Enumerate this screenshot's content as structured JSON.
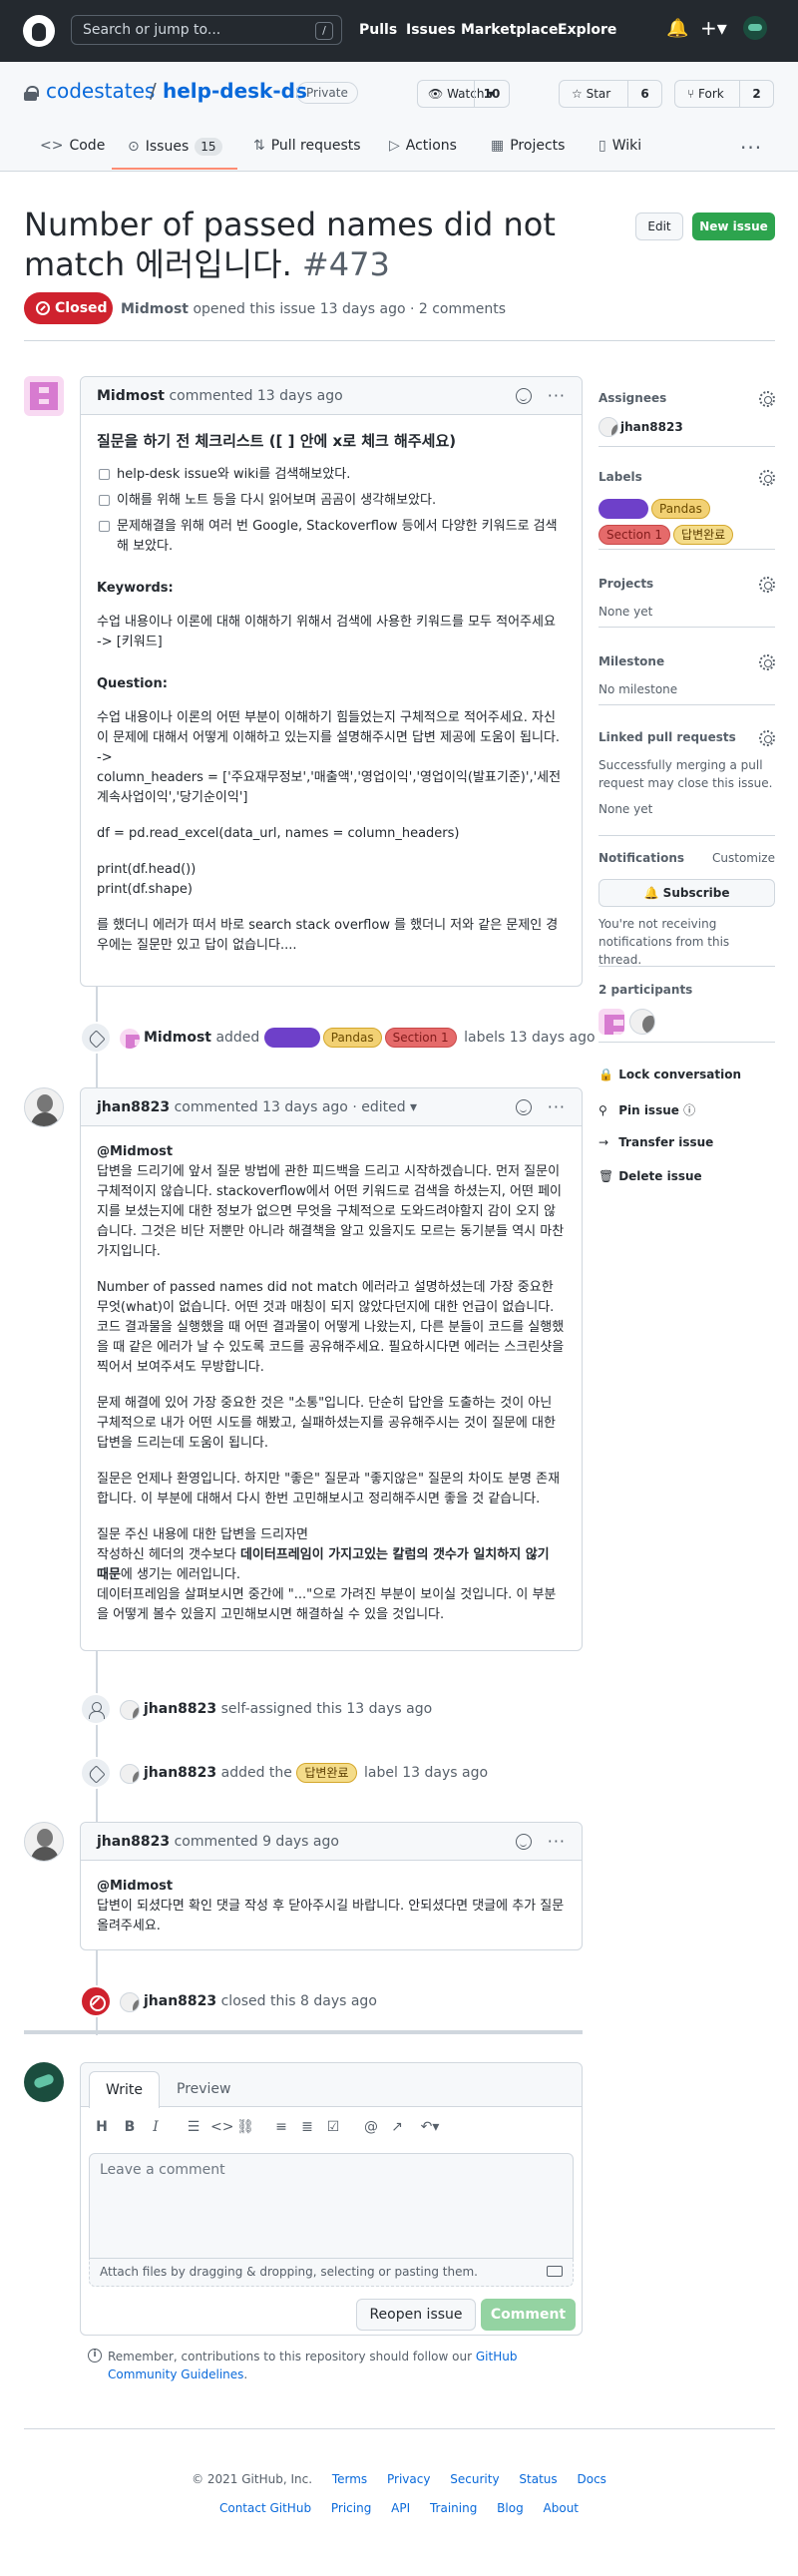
{
  "topbar": {
    "search_placeholder": "Search or jump to...",
    "slash_key": "/",
    "nav": [
      "Pulls",
      "Issues",
      "Marketplace",
      "Explore"
    ]
  },
  "repo": {
    "owner": "codestates",
    "separator": "/",
    "name": "help-desk-ds",
    "visibility": "Private",
    "watch_label": "Watch",
    "watch_count": "10",
    "star_label": "Star",
    "star_count": "6",
    "fork_label": "Fork",
    "fork_count": "2"
  },
  "tabs": {
    "code": "Code",
    "issues": "Issues",
    "issues_count": "15",
    "pulls": "Pull requests",
    "actions": "Actions",
    "projects": "Projects",
    "wiki": "Wiki"
  },
  "issue": {
    "title": "Number of passed names did not match 에러입니다.",
    "number": "#473",
    "state": "Closed",
    "author": "Midmost",
    "meta_rest": "opened this issue 13 days ago · 2 comments",
    "edit_label": "Edit",
    "new_issue_label": "New issue"
  },
  "comment1": {
    "author": "Midmost",
    "meta": "commented 13 days ago",
    "heading": "질문을 하기 전 체크리스트 ([ ] 안에 x로 체크 해주세요)",
    "checklist": [
      "help-desk issue와 wiki를 검색해보았다.",
      "이해를 위해 노트 등을 다시 읽어보며 곰곰이 생각해보았다.",
      "문제해결을 위해 여러 번 Google, Stackoverflow 등에서 다양한 키워드로 검색해 보았다."
    ],
    "keywords_title": "Keywords:",
    "keywords_body": "수업 내용이나 이론에 대해 이해하기 위해서 검색에 사용한 키워드를 모두 적어주세요",
    "keywords_arrow": "-> [키워드]",
    "question_title": "Question:",
    "question_body": "수업 내용이나 이론의 어떤 부분이 이해하기 힘들었는지 구체적으로 적어주세요. 자신이 문제에 대해서 어떻게 이해하고 있는지를 설명해주시면 답변 제공에 도움이 됩니다.",
    "question_arrow": "->",
    "code1": "column_headers = ['주요재무정보','매출액','영업이익','영업이익(발표기준)','세전계속사업이익','당기순이익']",
    "code2": "df = pd.read_excel(data_url, names = column_headers)",
    "code3": "print(df.head())",
    "code4": "print(df.shape)",
    "closing": "를 했더니 에러가 떠서 바로 search stack overflow 를 했더니 저와 같은 문제인 경우에는 질문만 있고 답이 없습니다...."
  },
  "event_label1": {
    "actor": "Midmost",
    "verb": "added",
    "labels": [
      "",
      "Pandas",
      "Section 1"
    ],
    "tail": "labels 13 days ago"
  },
  "comment2": {
    "author": "jhan8823",
    "meta": "commented 13 days ago · edited ▾",
    "mention": "@Midmost",
    "p1": "답변을 드리기에 앞서 질문 방법에 관한 피드백을 드리고 시작하겠습니다. 먼저 질문이 구체적이지 않습니다. stackoverflow에서 어떤 키워드로 검색을 하셨는지, 어떤 페이지를 보셨는지에 대한 정보가 없으면 무엇을 구체적으로 도와드려야할지 감이 오지 않습니다. 그것은 비단 저뿐만 아니라 해결책을 알고 있을지도 모르는 동기분들 역시 마찬가지입니다.",
    "p2": "Number of passed names did not match 에러라고 설명하셨는데 가장 중요한 무엇(what)이 없습니다. 어떤 것과 매칭이 되지 않았다던지에 대한 언급이 없습니다. 코드 결과물을 실행했을 때 어떤 결과물이 어떻게 나왔는지, 다른 분들이 코드를 실행했을 때 같은 에러가 날 수 있도록 코드를 공유해주세요. 필요하시다면 에러는 스크린샷을 찍어서 보여주셔도 무방합니다.",
    "p3": "문제 해결에 있어 가장 중요한 것은 \"소통\"입니다. 단순히 답안을 도출하는 것이 아닌 구체적으로 내가 어떤 시도를 해봤고, 실패하셨는지를 공유해주시는 것이 질문에 대한 답변을 드리는데 도움이 됩니다.",
    "p4": "질문은 언제나 환영입니다. 하지만 \"좋은\" 질문과 \"좋지않은\" 질문의 차이도 분명 존재합니다. 이 부분에 대해서 다시 한번 고민해보시고 정리해주시면 좋을 것 같습니다.",
    "p5a": "질문 주신 내용에 대한 답변을 드리자면",
    "p5b_pre": "작성하신 헤더의 갯수보다",
    "p5b_bold": "데이터프레임이 가지고있는 칼럼의 갯수가 일치하지 않기 때문",
    "p5b_post": "에 생기는 에러입니다.",
    "p5c": "데이터프레임을 살펴보시면 중간에 \"...\"으로 가려진 부분이 보이실 것입니다. 이 부분을 어떻게 볼수 있을지 고민해보시면 해결하실 수 있을 것입니다."
  },
  "event_assign": {
    "actor": "jhan8823",
    "tail": "self-assigned this 13 days ago"
  },
  "event_label2": {
    "actor": "jhan8823",
    "verb": "added the",
    "label": "답변완료",
    "tail": "label 13 days ago"
  },
  "comment3": {
    "author": "jhan8823",
    "meta": "commented 9 days ago",
    "mention": "@Midmost",
    "body": "답변이 되셨다면 확인 댓글 작성 후 닫아주시길 바랍니다. 안되셨다면 댓글에 추가 질문 올려주세요."
  },
  "event_closed": {
    "actor": "jhan8823",
    "tail": "closed this 8 days ago"
  },
  "sidebar": {
    "assignees_title": "Assignees",
    "assignee": "jhan8823",
    "labels_title": "Labels",
    "labels": [
      "",
      "Pandas",
      "Section 1",
      "답변완료"
    ],
    "projects_title": "Projects",
    "projects_value": "None yet",
    "milestone_title": "Milestone",
    "milestone_value": "No milestone",
    "linked_title": "Linked pull requests",
    "linked_desc": "Successfully merging a pull request may close this issue.",
    "linked_value": "None yet",
    "notifications_title": "Notifications",
    "customize": "Customize",
    "subscribe": "Subscribe",
    "notif_desc": "You're not receiving notifications from this thread.",
    "participants_title": "2 participants",
    "lock": "Lock conversation",
    "pin": "Pin issue",
    "transfer": "Transfer issue",
    "delete": "Delete issue"
  },
  "reply": {
    "tab_write": "Write",
    "tab_preview": "Preview",
    "placeholder": "Leave a comment",
    "attach": "Attach files by dragging & dropping, selecting or pasting them.",
    "reopen": "Reopen issue",
    "comment": "Comment",
    "remember_pre": "Remember, contributions to this repository should follow our",
    "remember_link": "GitHub Community Guidelines",
    "remember_post": "."
  },
  "footer": {
    "row1": [
      "© 2021 GitHub, Inc.",
      "Terms",
      "Privacy",
      "Security",
      "Status",
      "Docs"
    ],
    "row2": [
      "Contact GitHub",
      "Pricing",
      "API",
      "Training",
      "Blog",
      "About"
    ]
  }
}
